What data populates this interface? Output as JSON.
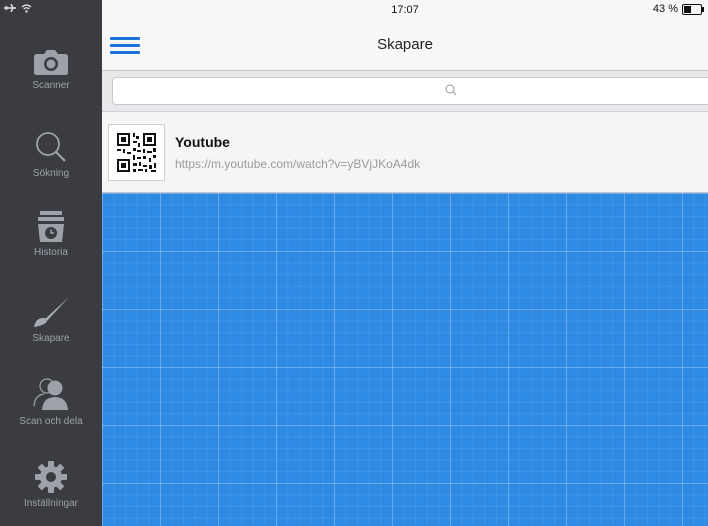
{
  "status": {
    "time": "17:07",
    "battery": "43 %",
    "battery_level": 0.43
  },
  "sidebar": {
    "items": [
      {
        "label": "Scanner",
        "icon": "camera-icon"
      },
      {
        "label": "Sökning",
        "icon": "search-icon"
      },
      {
        "label": "Historia",
        "icon": "history-icon"
      },
      {
        "label": "Skapare",
        "icon": "brush-icon"
      },
      {
        "label": "Scan och dela",
        "icon": "share-user-icon"
      },
      {
        "label": "Inställningar",
        "icon": "gear-icon"
      }
    ]
  },
  "header": {
    "title": "Skapare"
  },
  "search": {
    "placeholder": ""
  },
  "list": {
    "items": [
      {
        "title": "Youtube",
        "url": "https://m.youtube.com/watch?v=yBVjJKoA4dk",
        "icon": "qr-code-icon"
      }
    ]
  },
  "colors": {
    "accent": "#1a73d9",
    "sidebar": "#3a3c41",
    "blueprint": "#2f8ae3"
  }
}
